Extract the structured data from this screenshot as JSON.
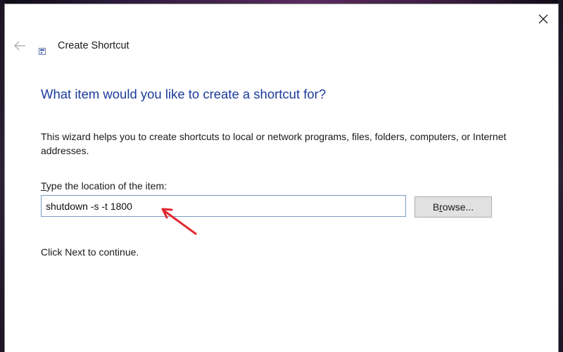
{
  "window": {
    "title": "Create Shortcut",
    "back_icon": "back-arrow-icon",
    "close_icon": "close-icon"
  },
  "content": {
    "heading": "What item would you like to create a shortcut for?",
    "description": "This wizard helps you to create shortcuts to local or network programs, files, folders, computers, or Internet addresses.",
    "location_label_accel": "T",
    "location_label_rest": "ype the location of the item:",
    "location_value": "shutdown -s -t 1800",
    "browse_accel_before": "B",
    "browse_accel_key": "r",
    "browse_accel_after": "owse...",
    "continue_text": "Click Next to continue."
  },
  "annotation": {
    "arrow_icon": "red-arrow-icon",
    "color": "#e0282f"
  },
  "colors": {
    "heading": "#1c3b9c",
    "input_border": "#7a9cc6",
    "button_bg": "#e1e1e1"
  }
}
